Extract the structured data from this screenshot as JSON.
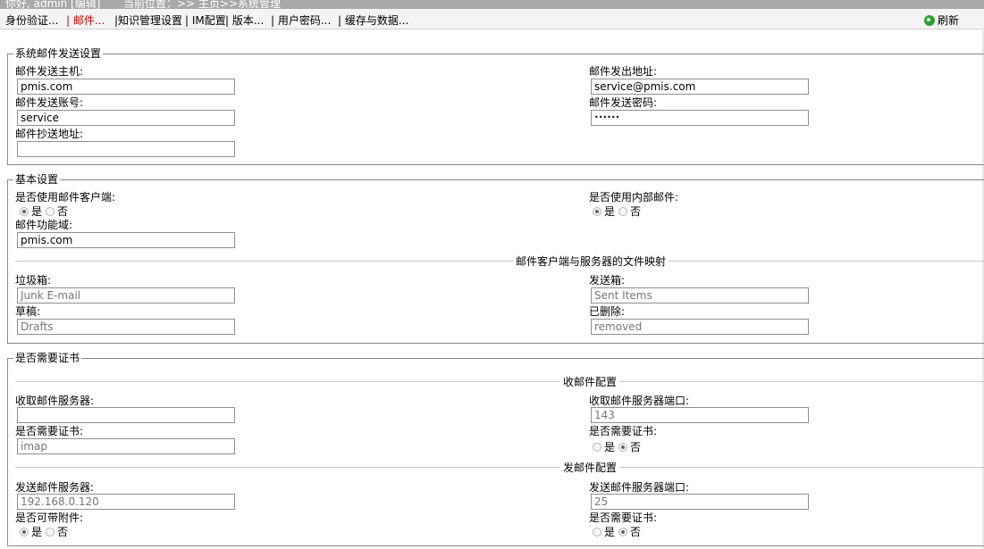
{
  "header": {
    "greeting": "你好, admin [编辑]",
    "location": "当前位置：>> 主页>>系统管理"
  },
  "tabs": [
    {
      "label": "身份验证..."
    },
    {
      "label": "| 邮件..."
    },
    {
      "label": "|知识管理设置"
    },
    {
      "label": "| IM配置"
    },
    {
      "label": "| 版本..."
    },
    {
      "label": "| 用户密码..."
    },
    {
      "label": "| 缓存与数据..."
    }
  ],
  "refresh_label": "刷新",
  "send_settings": {
    "legend": "系统邮件发送设置",
    "host_label": "邮件发送主机:",
    "host_value": "pmis.com",
    "from_label": "邮件发出地址:",
    "from_value": "service@pmis.com",
    "account_label": "邮件发送账号:",
    "account_value": "service",
    "password_label": "邮件发送密码:",
    "password_value": "••••••",
    "cc_label": "邮件抄送地址:",
    "cc_value": ""
  },
  "basic": {
    "legend": "基本设置",
    "use_client_label": "是否使用邮件客户端:",
    "use_internal_label": "是否使用内部邮件:",
    "yes": "是",
    "no": "否",
    "domain_label": "邮件功能域:",
    "domain_value": "pmis.com",
    "mapping_title": "邮件客户端与服务器的文件映射",
    "junk_label": "垃圾箱:",
    "junk_value": "Junk E-mail",
    "sent_label": "发送箱:",
    "sent_value": "Sent Items",
    "drafts_label": "草稿:",
    "drafts_value": "Drafts",
    "deleted_label": "已删除:",
    "deleted_value": "removed"
  },
  "cert": {
    "legend": "是否需要证书",
    "receive_title": "收邮件配置",
    "recv_server_label": "收取邮件服务器:",
    "recv_server_value": "",
    "recv_port_label": "收取邮件服务器端口:",
    "recv_port_value": "143",
    "recv_proto_label": "是否需要证书:",
    "recv_proto_value": "imap",
    "recv_cert_label": "是否需要证书:",
    "send_title": "发邮件配置",
    "send_server_label": "发送邮件服务器:",
    "send_server_value": "192.168.0.120",
    "send_port_label": "发送邮件服务器端口:",
    "send_port_value": "25",
    "attach_label": "是否可带附件:",
    "send_cert_label": "是否需要证书:",
    "yes": "是",
    "no": "否"
  }
}
